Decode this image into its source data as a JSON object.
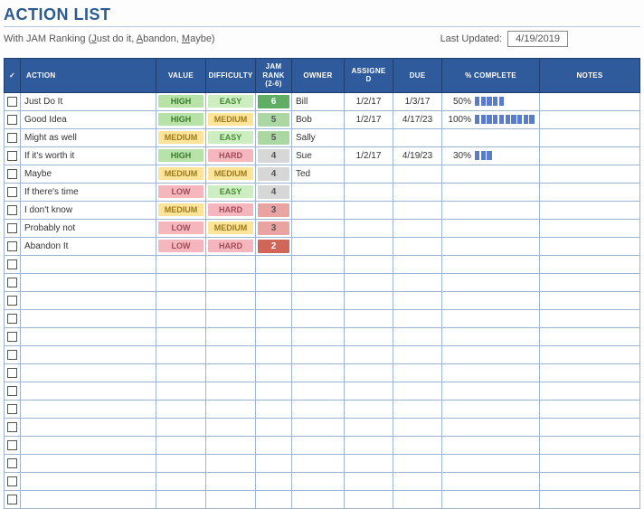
{
  "header": {
    "title": "ACTION LIST",
    "subtitle_prefix": "With JAM Ranking (",
    "jam_j": "J",
    "jam_j_rest": "ust do it, ",
    "jam_a": "A",
    "jam_a_rest": "bandon, ",
    "jam_m": "M",
    "jam_m_rest": "aybe)",
    "last_updated_label": "Last Updated:",
    "last_updated_value": "4/19/2019"
  },
  "columns": {
    "check": "✓",
    "action": "ACTION",
    "value": "VALUE",
    "difficulty": "DIFFICULTY",
    "rank_l1": "JAM",
    "rank_l2": "RANK",
    "rank_l3": "(2-6)",
    "owner": "OWNER",
    "assigned_l1": "ASSIGNE",
    "assigned_l2": "D",
    "due": "DUE",
    "pct": "% COMPLETE",
    "notes": "NOTES"
  },
  "rows": [
    {
      "action": "Just Do It",
      "value": "HIGH",
      "difficulty": "EASY",
      "rank": 6,
      "owner": "Bill",
      "assigned": "1/2/17",
      "due": "1/3/17",
      "pct": 50
    },
    {
      "action": "Good Idea",
      "value": "HIGH",
      "difficulty": "MEDIUM",
      "rank": 5,
      "owner": "Bob",
      "assigned": "1/2/17",
      "due": "4/17/23",
      "pct": 100
    },
    {
      "action": "Might as well",
      "value": "MEDIUM",
      "difficulty": "EASY",
      "rank": 5,
      "owner": "Sally",
      "assigned": "",
      "due": "",
      "pct": null
    },
    {
      "action": "If it's worth it",
      "value": "HIGH",
      "difficulty": "HARD",
      "rank": 4,
      "owner": "Sue",
      "assigned": "1/2/17",
      "due": "4/19/23",
      "pct": 30
    },
    {
      "action": "Maybe",
      "value": "MEDIUM",
      "difficulty": "MEDIUM",
      "rank": 4,
      "owner": "Ted",
      "assigned": "",
      "due": "",
      "pct": null
    },
    {
      "action": "If there's time",
      "value": "LOW",
      "difficulty": "EASY",
      "rank": 4,
      "owner": "",
      "assigned": "",
      "due": "",
      "pct": null
    },
    {
      "action": "I don't know",
      "value": "MEDIUM",
      "difficulty": "HARD",
      "rank": 3,
      "owner": "",
      "assigned": "",
      "due": "",
      "pct": null
    },
    {
      "action": "Probably not",
      "value": "LOW",
      "difficulty": "MEDIUM",
      "rank": 3,
      "owner": "",
      "assigned": "",
      "due": "",
      "pct": null
    },
    {
      "action": "Abandon It",
      "value": "LOW",
      "difficulty": "HARD",
      "rank": 2,
      "owner": "",
      "assigned": "",
      "due": "",
      "pct": null
    }
  ],
  "empty_rows": 14
}
